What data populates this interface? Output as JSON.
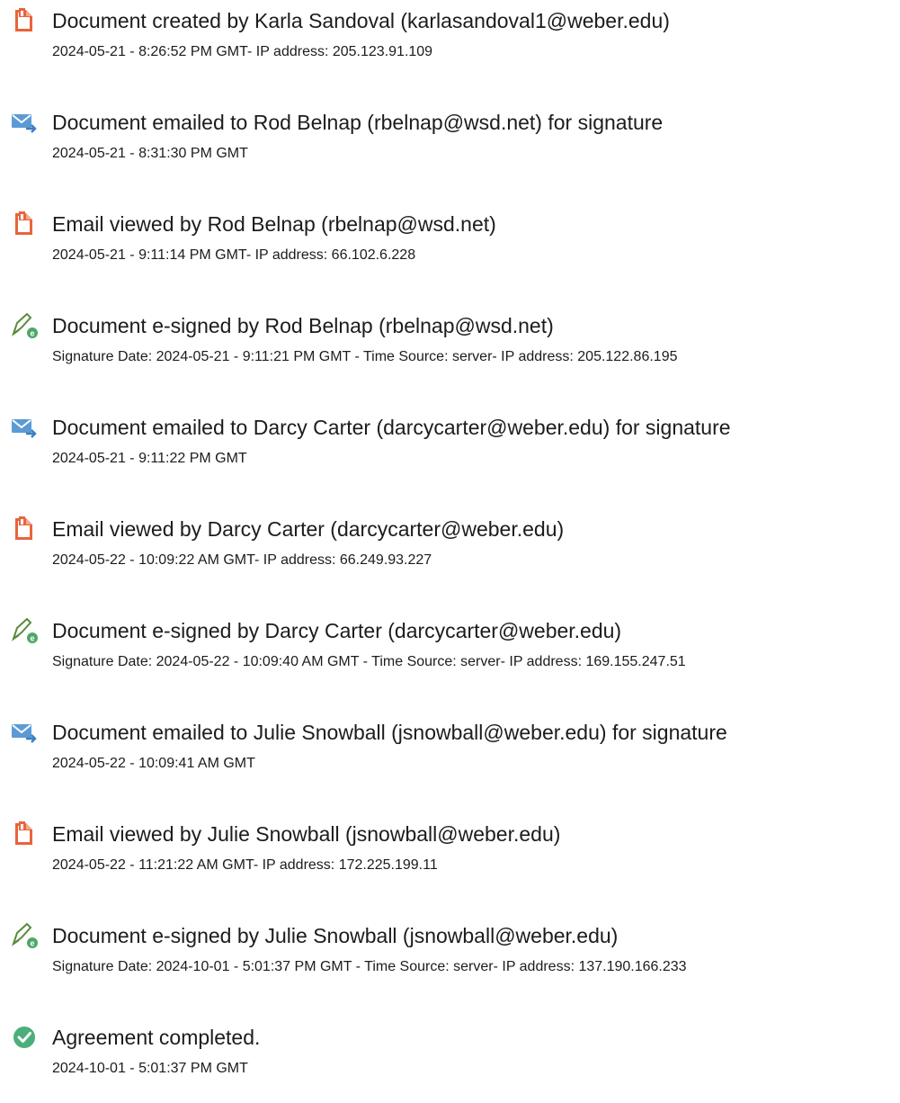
{
  "colors": {
    "created_icon": "#E8643C",
    "email_icon": "#5B9BD5",
    "esign_icon": "#4CA86A",
    "complete_icon": "#4CAF7A"
  },
  "events": [
    {
      "icon": "document-created-icon",
      "title": "Document created by Karla Sandoval (karlasandoval1@weber.edu)",
      "detail": "2024-05-21 - 8:26:52 PM GMT- IP address: 205.123.91.109"
    },
    {
      "icon": "email-sent-icon",
      "title": "Document emailed to Rod Belnap (rbelnap@wsd.net) for signature",
      "detail": "2024-05-21 - 8:31:30 PM GMT"
    },
    {
      "icon": "email-viewed-icon",
      "title": "Email viewed by Rod Belnap (rbelnap@wsd.net)",
      "detail": "2024-05-21 - 9:11:14 PM GMT- IP address: 66.102.6.228"
    },
    {
      "icon": "e-signed-icon",
      "title": "Document e-signed by Rod Belnap (rbelnap@wsd.net)",
      "detail": "Signature Date: 2024-05-21 - 9:11:21 PM GMT - Time Source: server- IP address: 205.122.86.195"
    },
    {
      "icon": "email-sent-icon",
      "title": "Document emailed to Darcy Carter (darcycarter@weber.edu) for signature",
      "detail": "2024-05-21 - 9:11:22 PM GMT"
    },
    {
      "icon": "email-viewed-icon",
      "title": "Email viewed by Darcy Carter (darcycarter@weber.edu)",
      "detail": "2024-05-22 - 10:09:22 AM GMT- IP address: 66.249.93.227"
    },
    {
      "icon": "e-signed-icon",
      "title": "Document e-signed by Darcy Carter (darcycarter@weber.edu)",
      "detail": "Signature Date: 2024-05-22 - 10:09:40 AM GMT - Time Source: server- IP address: 169.155.247.51"
    },
    {
      "icon": "email-sent-icon",
      "title": "Document emailed to Julie Snowball (jsnowball@weber.edu) for signature",
      "detail": "2024-05-22 - 10:09:41 AM GMT"
    },
    {
      "icon": "email-viewed-icon",
      "title": "Email viewed by Julie Snowball (jsnowball@weber.edu)",
      "detail": "2024-05-22 - 11:21:22 AM GMT- IP address: 172.225.199.11"
    },
    {
      "icon": "e-signed-icon",
      "title": "Document e-signed by Julie Snowball (jsnowball@weber.edu)",
      "detail": "Signature Date: 2024-10-01 - 5:01:37 PM GMT - Time Source: server- IP address: 137.190.166.233"
    },
    {
      "icon": "agreement-completed-icon",
      "title": "Agreement completed.",
      "detail": "2024-10-01 - 5:01:37 PM GMT"
    }
  ]
}
